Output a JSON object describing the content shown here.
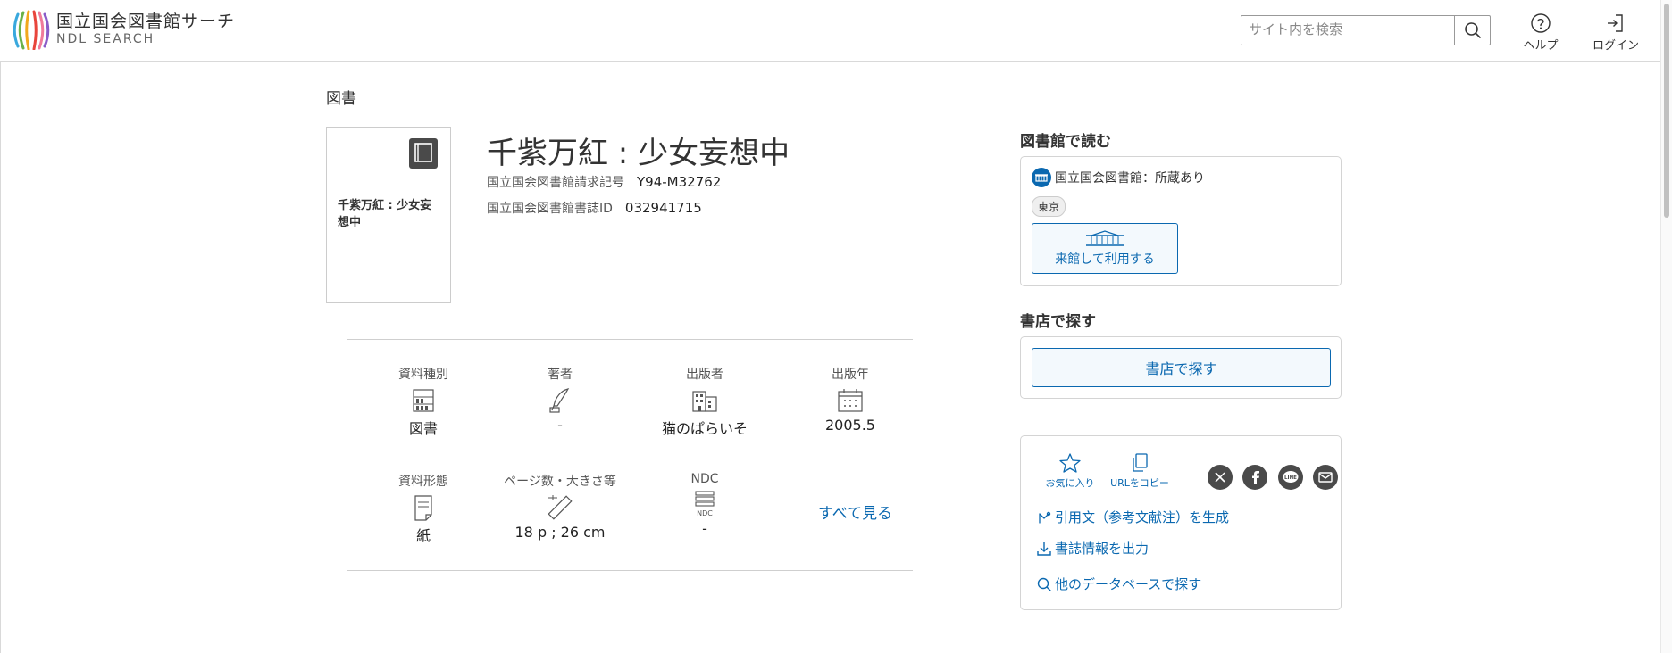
{
  "header": {
    "logo_jp": "国立国会図書館サーチ",
    "logo_en": "NDL SEARCH",
    "search_placeholder": "サイト内を検索",
    "help_label": "ヘルプ",
    "login_label": "ログイン",
    "logo_colors": [
      "#f2a81d",
      "#e8453c",
      "#39a8dd",
      "#6ab24a",
      "#8a5cc8",
      "#f07b9a"
    ]
  },
  "record": {
    "category": "図書",
    "thumb_title": "千紫万紅 : 少女妄想中",
    "title": "千紫万紅 : 少女妄想中",
    "call_number_label": "国立国会図書館請求記号",
    "call_number": "Y94-M32762",
    "bib_id_label": "国立国会図書館書誌ID",
    "bib_id": "032941715"
  },
  "facts": [
    {
      "label": "資料種別",
      "value": "図書",
      "icon": "book-shelf-icon"
    },
    {
      "label": "著者",
      "value": "-",
      "icon": "quill-pen-icon"
    },
    {
      "label": "出版者",
      "value": "猫のぱらいそ",
      "icon": "building-icon"
    },
    {
      "label": "出版年",
      "value": "2005.5",
      "icon": "calendar-icon"
    },
    {
      "label": "資料形態",
      "value": "紙",
      "icon": "paper-icon"
    },
    {
      "label": "ページ数・大きさ等",
      "value": "18 p ; 26 cm",
      "icon": "ruler-icon"
    },
    {
      "label": "NDC",
      "value": "-",
      "icon": "ndc-icon",
      "icon_text": "NDC"
    }
  ],
  "see_all": "すべて見る",
  "library": {
    "heading": "図書館で読む",
    "holding": "国立国会図書館：所蔵あり",
    "tag": "東京",
    "visit_button": "来館して利用する"
  },
  "shop": {
    "heading": "書店で探す",
    "button": "書店で探す"
  },
  "share": {
    "favorite": "お気に入り",
    "copy_url": "URLをコピー",
    "line_text": "LINE",
    "links": {
      "citation": "引用文（参考文献注）を生成",
      "export": "書誌情報を出力",
      "other_db": "他のデータベースで探す"
    }
  },
  "colors": {
    "accent": "#0a68b0",
    "icon_dark": "#4a4a4a",
    "border": "#d4d4d4"
  }
}
